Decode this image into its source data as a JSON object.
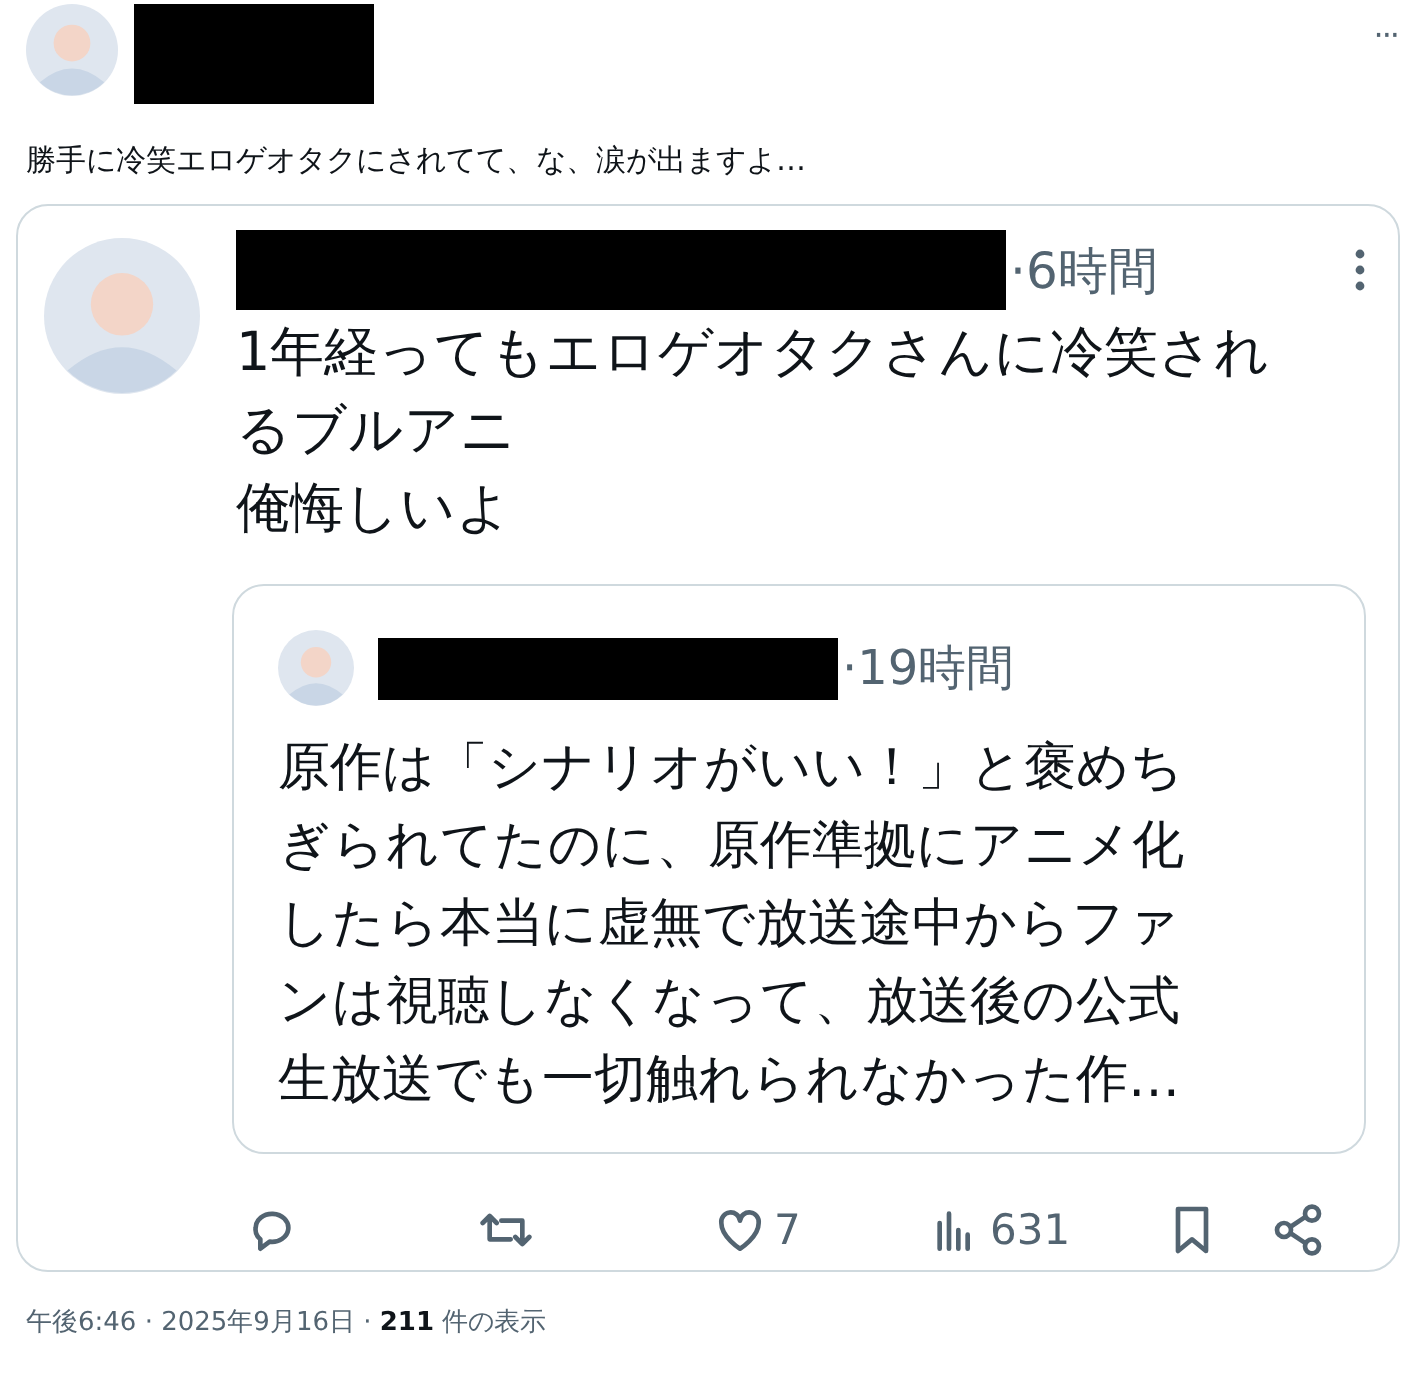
{
  "post": {
    "more": "···",
    "text": "勝手に冷笑エロゲオタクにされてて、な、涙が出ますよ…"
  },
  "quoted": {
    "time": "·6時間",
    "lines": [
      "1年経ってもエロゲオタクさんに冷笑されるブルアニ",
      "俺悔しいよ"
    ],
    "quoted": {
      "time": "·19時間",
      "text": "原作は「シナリオがいい！」と褒めちぎられてたのに、原作準拠にアニメ化したら本当に虚無で放送途中からファンは視聴しなくなって、放送後の公式生放送でも一切触れられなかった作…"
    },
    "actions": [
      {
        "kind": "reply"
      },
      {
        "kind": "repost"
      },
      {
        "kind": "like",
        "count": "7"
      },
      {
        "kind": "views",
        "count": "631"
      },
      {
        "kind": "bookmark"
      },
      {
        "kind": "share"
      }
    ]
  },
  "footer": "午後6:46 · 2025年9月16日 · **211** 件の表示"
}
